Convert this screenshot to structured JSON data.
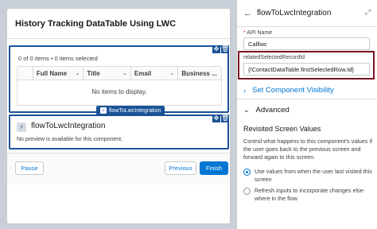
{
  "screen": {
    "title": "History Tracking DataTable Using LWC",
    "datatable": {
      "count_text": "0 of 0 items • 0 items selected",
      "columns": [
        "Full Name",
        "Title",
        "Email",
        "Business ..."
      ],
      "empty_text": "No items to display.",
      "component_tag": "flowToLwcIntegration"
    },
    "lwc_component": {
      "title": "flowToLwcIntegration",
      "subtitle": "No preview is available for this component."
    },
    "footer": {
      "pause_label": "Pause",
      "previous_label": "Previous",
      "finish_label": "Finish"
    }
  },
  "panel": {
    "title": "flowToLwcIntegration",
    "api_name_label": "API Name",
    "api_name_required": "*",
    "api_name_value": "Calllwc",
    "related_label": "relatedSelectedRecordId",
    "related_value": "{!ContactDataTable.firstSelectedRow.Id}",
    "set_visibility_label": "Set Component Visibility",
    "advanced_label": "Advanced",
    "revisited_title": "Revisited Screen Values",
    "revisited_desc": "Control what happens to this component's values if the user goes back to the previous screen and forward again to this screen.",
    "option_1": "Use values from when the user last visited this screen",
    "option_2": "Refresh inputs to incorporate changes else-where in the flow"
  },
  "colors": {
    "brand_blue": "#0176d3",
    "selection_blue": "#1b5297",
    "highlight_red": "#7a1422"
  }
}
